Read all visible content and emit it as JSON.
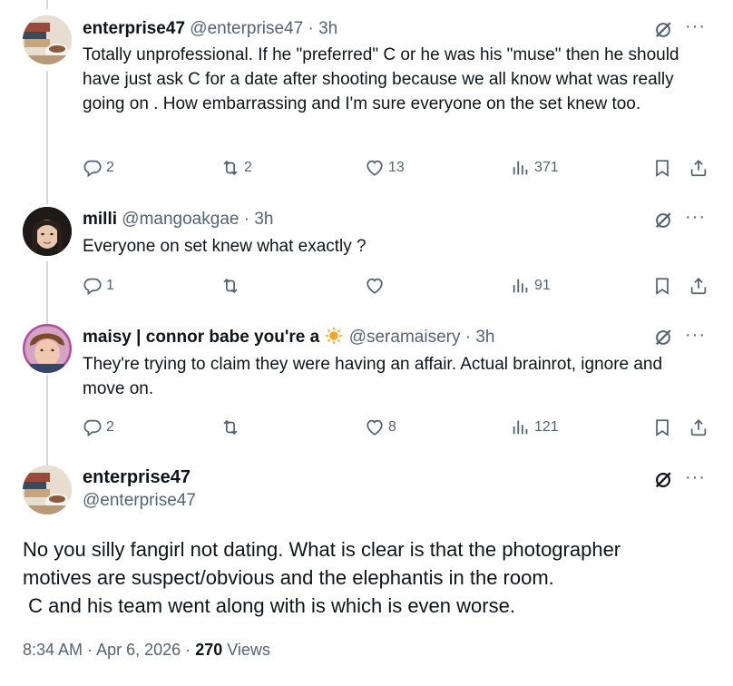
{
  "replies": [
    {
      "name": "enterprise47",
      "handle": "@enterprise47",
      "dot": "·",
      "time": "3h",
      "text": "Totally unprofessional.  If he \"preferred\" C or he was his \"muse\" then he should have just ask C for a date after shooting because we all know what was really going on . How embarrassing and I'm sure everyone on the set knew too.",
      "replies_count": "2",
      "reposts_count": "2",
      "likes_count": "13",
      "views_count": "371"
    },
    {
      "name": "milli",
      "handle": "@mangoakgae",
      "dot": "·",
      "time": "3h",
      "text": "Everyone on set knew what exactly ?",
      "replies_count": "1",
      "reposts_count": "",
      "likes_count": "",
      "views_count": "91"
    },
    {
      "name": "maisy | connor babe you're a",
      "name_emoji": "sun-emoji",
      "handle": "@seramaisery",
      "dot": "·",
      "time": "3h",
      "text": "They're trying to claim they were having an affair. Actual brainrot, ignore and move on.",
      "replies_count": "2",
      "reposts_count": "",
      "likes_count": "8",
      "views_count": "121"
    }
  ],
  "main_tweet": {
    "name": "enterprise47",
    "handle": "@enterprise47",
    "lines": [
      "No you silly fangirl not dating. What is clear is that the photographer",
      "motives are suspect/obvious and the elephantis in the room.",
      " C and his team went along with is which is even worse."
    ],
    "time": "8:34 AM",
    "dot": "·",
    "date": "Apr 6, 2026",
    "dot2": "·",
    "views": "270",
    "views_label": "Views"
  },
  "menu_glyph": "···",
  "colors": {
    "text": "#0f1419",
    "secondary": "#536471",
    "thread_line": "#cfd9de",
    "background": "#ffffff"
  }
}
